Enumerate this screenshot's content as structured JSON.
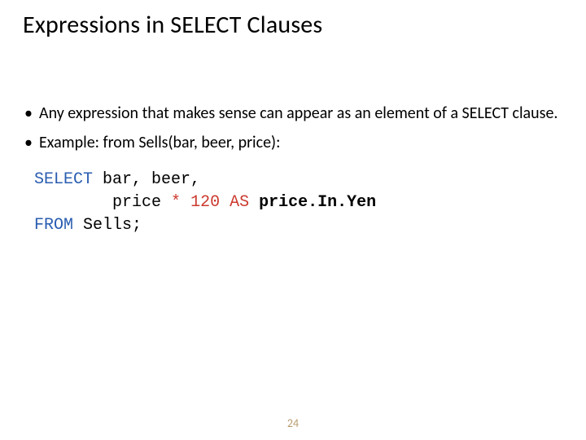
{
  "slide": {
    "title": "Expressions in SELECT Clauses",
    "bullets": [
      "Any expression that makes sense can appear as an element of a SELECT clause.",
      "Example: from Sells(bar, beer, price):"
    ],
    "code": {
      "select_kw": "SELECT",
      "cols": " bar, beer,",
      "indent": "        ",
      "expr_left": "price ",
      "star": "*",
      "space1": " ",
      "num": "120",
      "space2": " ",
      "as_kw": "AS",
      "space3": " ",
      "alias": "price.In.Yen",
      "from_kw": "FROM",
      "from_rest": " Sells;"
    },
    "page_number": "24"
  }
}
